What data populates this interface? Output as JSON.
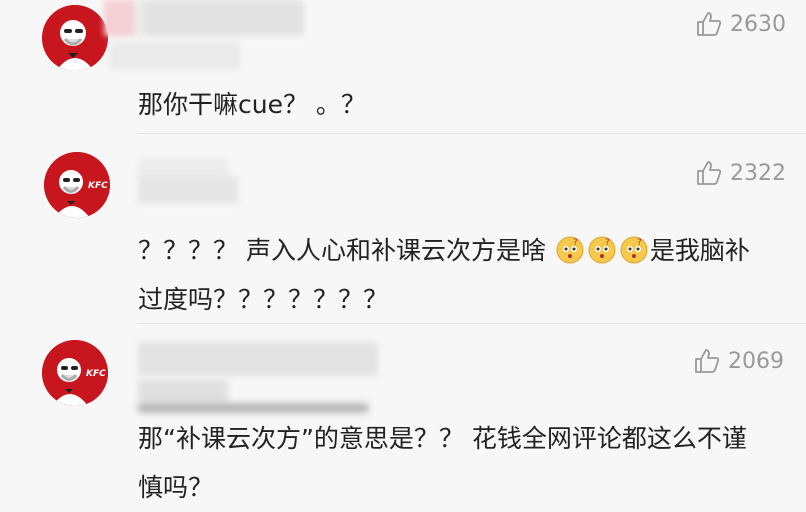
{
  "comments": [
    {
      "likes": "2630",
      "text": "那你干嘛cue？ 。？"
    },
    {
      "likes": "2322",
      "text_before_emoji": "？？？？ 声入人心和补课云次方是啥 ",
      "text_after_emoji": "是我脑补过度吗？？？？？？？"
    },
    {
      "likes": "2069",
      "text": "那“补课云次方”的意思是？？ 花钱全网评论都这么不谨慎吗？"
    }
  ],
  "icons": {
    "like": "thumbs-up-icon",
    "avatar": "kfc-colonel-logo",
    "emoji": "confused-face-emoji"
  },
  "colors": {
    "avatar_red": "#c8161e",
    "meta_gray": "#999999",
    "background": "#f7f7f7"
  }
}
